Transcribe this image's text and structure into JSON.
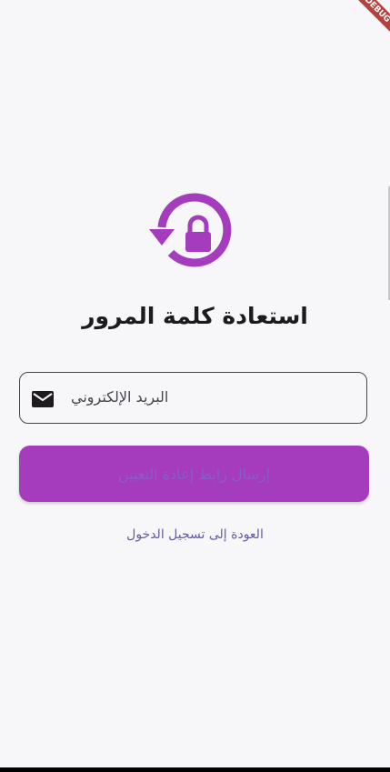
{
  "banner": {
    "text": "DEBUG"
  },
  "icons": {
    "logo": "lock-reset-icon",
    "email": "mail-icon"
  },
  "colors": {
    "accent": "#a43cbd",
    "button_text": "#8a5bcc",
    "link": "#6a58a8",
    "title": "#1d1b20",
    "background": "#f7f6f8"
  },
  "page": {
    "title": "استعادة كلمة المرور"
  },
  "form": {
    "email_placeholder": "البريد الإلكتروني",
    "email_value": "",
    "send_label": "إرسال رابط إعادة التعيين"
  },
  "links": {
    "back_to_login": "العودة إلى تسجيل الدخول"
  }
}
